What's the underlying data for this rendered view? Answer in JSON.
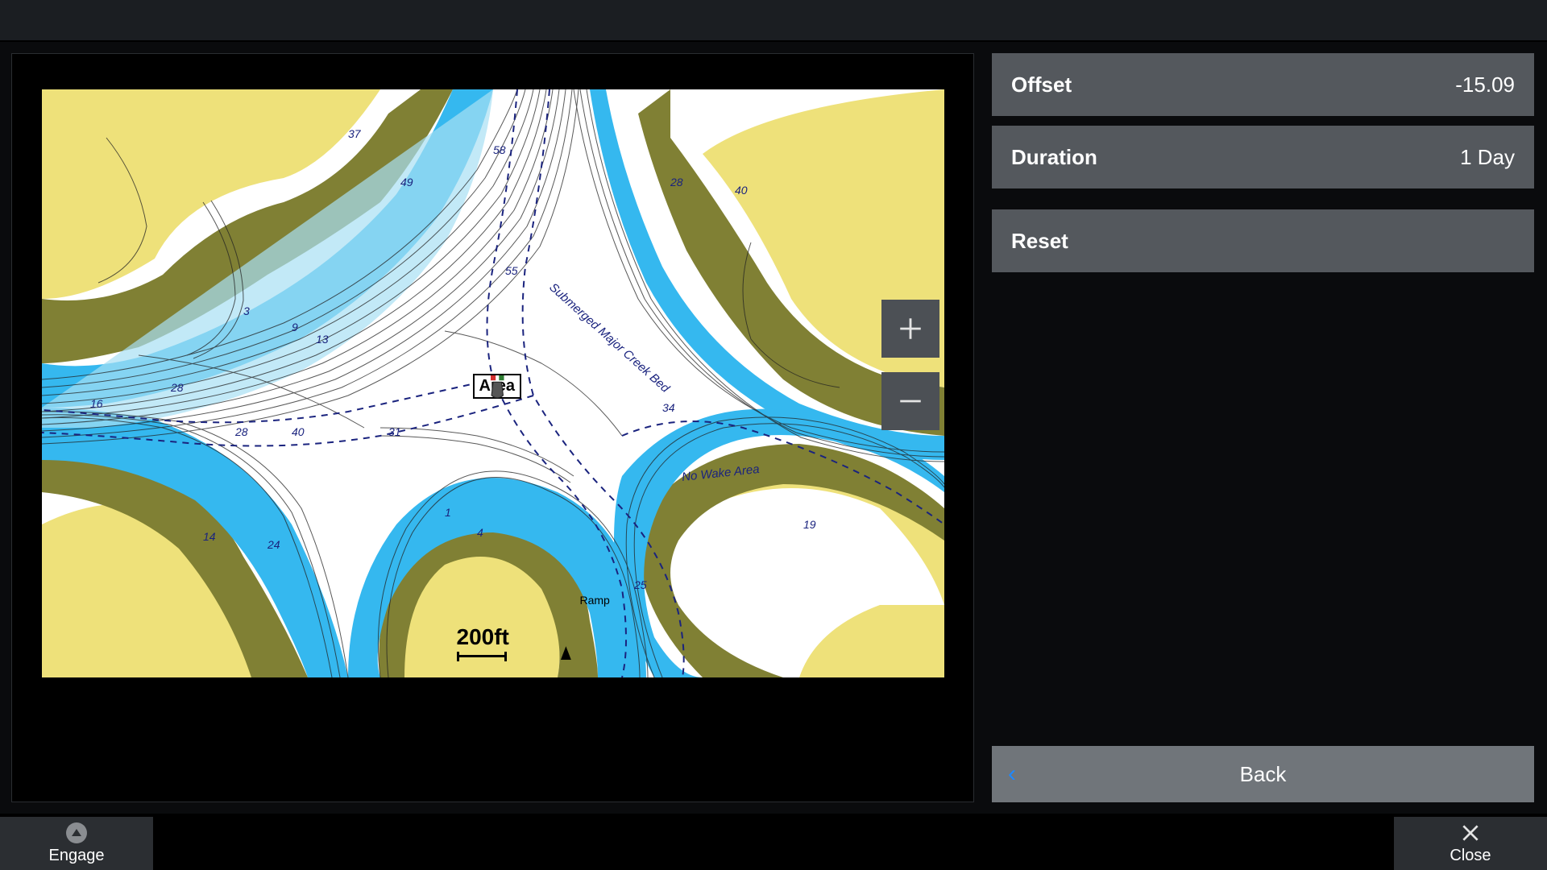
{
  "settings": {
    "offset": {
      "label": "Offset",
      "value": "-15.09"
    },
    "duration": {
      "label": "Duration",
      "value": "1 Day"
    },
    "reset": {
      "label": "Reset"
    },
    "back": {
      "label": "Back"
    }
  },
  "bottom": {
    "engage": "Engage",
    "close": "Close"
  },
  "map": {
    "scale": "200ft",
    "area_label": "Area",
    "creek_label": "Submerged Major Creek Bed",
    "nowake_label": "No Wake Area",
    "ramp_label": "Ramp",
    "depths": [
      "37",
      "49",
      "58",
      "28",
      "40",
      "3",
      "9",
      "13",
      "55",
      "28",
      "31",
      "34",
      "16",
      "28",
      "40",
      "14",
      "24",
      "25",
      "19",
      "1",
      "4"
    ]
  }
}
